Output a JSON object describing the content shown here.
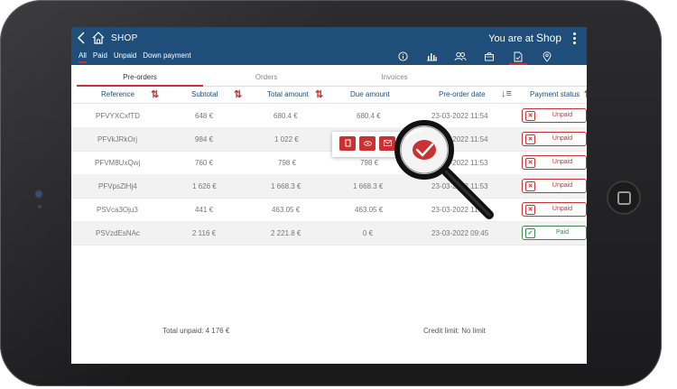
{
  "app": {
    "back_icon": "chevron-left-icon",
    "home_icon": "home-icon",
    "title": "SHOP",
    "location_prefix": "You are at",
    "location_place": "Shop"
  },
  "filters": [
    {
      "label": "All",
      "active": true
    },
    {
      "label": "Paid",
      "active": false
    },
    {
      "label": "Unpaid",
      "active": false
    },
    {
      "label": "Down payment",
      "active": false
    }
  ],
  "nav_icons": [
    "info-icon",
    "bar-chart-icon",
    "users-icon",
    "shopping-bag-icon",
    "document-icon",
    "location-pin-icon"
  ],
  "tabs": [
    {
      "label": "Pre-orders",
      "active": true
    },
    {
      "label": "Orders",
      "active": false
    },
    {
      "label": "Invoices",
      "active": false
    }
  ],
  "columns": {
    "reference": "Reference",
    "subtotal": "Subtotal",
    "total": "Total amount",
    "due": "Due amount",
    "date": "Pre-order date",
    "status": "Payment status"
  },
  "rows": [
    {
      "reference": "PFVYXCxfTD",
      "subtotal": "648 €",
      "total": "680.4 €",
      "due": "680.4 €",
      "date": "23-03-2022 11:54",
      "status": "Unpaid"
    },
    {
      "reference": "PFVkJRkOrj",
      "subtotal": "984 €",
      "total": "1 022 €",
      "due": "",
      "date": "23-03-2022 11:54",
      "status": "Unpaid"
    },
    {
      "reference": "PFVM8UxQwj",
      "subtotal": "760 €",
      "total": "798 €",
      "due": "798 €",
      "date": "23-03-2022 11:53",
      "status": "Unpaid"
    },
    {
      "reference": "PFVpsZlHj4",
      "subtotal": "1 626 €",
      "total": "1 668.3 €",
      "due": "1 668.3 €",
      "date": "23-03-2022 11:53",
      "status": "Unpaid"
    },
    {
      "reference": "PSVca3Oju3",
      "subtotal": "441 €",
      "total": "463.05 €",
      "due": "463.05 €",
      "date": "23-03-2022 11:53",
      "status": "Unpaid"
    },
    {
      "reference": "PSVzdEsNAc",
      "subtotal": "2 116 €",
      "total": "2 221.8 €",
      "due": "0 €",
      "date": "23-03-2022 09:45",
      "status": "Paid"
    }
  ],
  "row_actions": [
    "copy-icon",
    "eye-icon",
    "mail-icon"
  ],
  "footer": {
    "total_unpaid": "Total unpaid: 4 176 €",
    "credit_limit": "Credit limit: No limit"
  },
  "colors": {
    "header_bg": "#1e4e79",
    "accent": "#c83232",
    "paid": "#3a8a4a"
  }
}
